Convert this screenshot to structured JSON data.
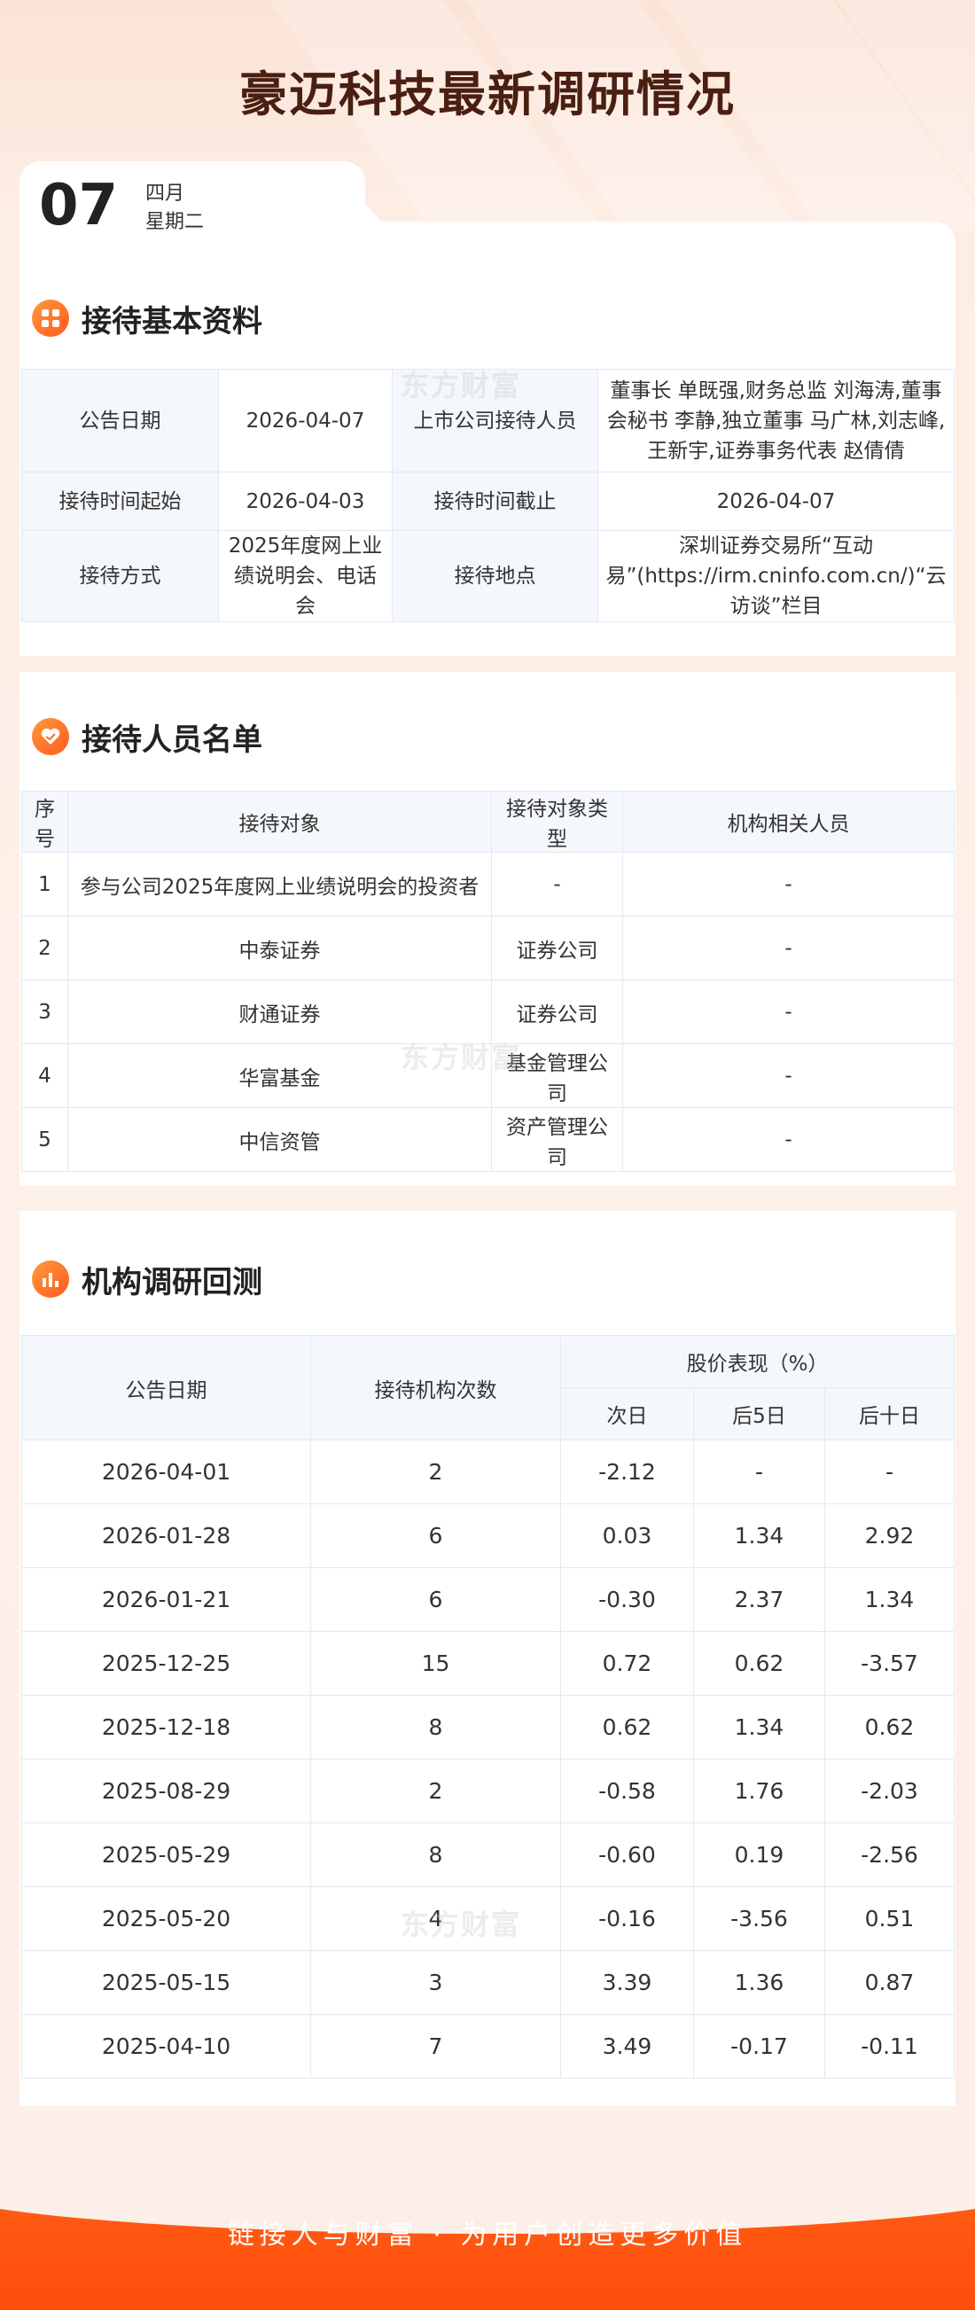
{
  "page": {
    "title": "豪迈科技最新调研情况",
    "date": {
      "day": "07",
      "month": "四月",
      "weekday": "星期二"
    },
    "watermark": "东方财富",
    "footer_slogan": "链接人与财富 · 为用户创造更多价值",
    "colors": {
      "accent": "#ff5a1f",
      "title": "#4a1f12",
      "header_bg": "#f4f8fc"
    }
  },
  "basic": {
    "section_title": "接待基本资料",
    "icon": "grid-icon",
    "announce_date_label": "公告日期",
    "announce_date": "2026-04-07",
    "receivers_label": "上市公司接待人员",
    "receivers": "董事长 单既强,财务总监 刘海涛,董事会秘书 李静,独立董事 马广林,刘志峰,王新宇,证券事务代表 赵倩倩",
    "start_label": "接待时间起始",
    "start": "2026-04-03",
    "end_label": "接待时间截止",
    "end": "2026-04-07",
    "method_label": "接待方式",
    "method": "2025年度网上业绩说明会、电话会",
    "place_label": "接待地点",
    "place": "深圳证券交易所“互动易”(https://irm.cninfo.com.cn/)“云访谈”栏目"
  },
  "visitors": {
    "section_title": "接待人员名单",
    "icon": "handshake-icon",
    "headers": [
      "序号",
      "接待对象",
      "接待对象类型",
      "机构相关人员"
    ],
    "rows": [
      [
        "1",
        "参与公司2025年度网上业绩说明会的投资者",
        "-",
        "-"
      ],
      [
        "2",
        "中泰证券",
        "证券公司",
        "-"
      ],
      [
        "3",
        "财通证券",
        "证券公司",
        "-"
      ],
      [
        "4",
        "华富基金",
        "基金管理公司",
        "-"
      ],
      [
        "5",
        "中信资管",
        "资产管理公司",
        "-"
      ]
    ]
  },
  "backtest": {
    "section_title": "机构调研回测",
    "icon": "bar-chart-icon",
    "headers": {
      "date": "公告日期",
      "count": "接待机构次数",
      "perf": "股价表现（%）",
      "next_day": "次日",
      "after5": "后5日",
      "after10": "后十日"
    },
    "rows": [
      [
        "2026-04-01",
        "2",
        "-2.12",
        "-",
        "-"
      ],
      [
        "2026-01-28",
        "6",
        "0.03",
        "1.34",
        "2.92"
      ],
      [
        "2026-01-21",
        "6",
        "-0.30",
        "2.37",
        "1.34"
      ],
      [
        "2025-12-25",
        "15",
        "0.72",
        "0.62",
        "-3.57"
      ],
      [
        "2025-12-18",
        "8",
        "0.62",
        "1.34",
        "0.62"
      ],
      [
        "2025-08-29",
        "2",
        "-0.58",
        "1.76",
        "-2.03"
      ],
      [
        "2025-05-29",
        "8",
        "-0.60",
        "0.19",
        "-2.56"
      ],
      [
        "2025-05-20",
        "4",
        "-0.16",
        "-3.56",
        "0.51"
      ],
      [
        "2025-05-15",
        "3",
        "3.39",
        "1.36",
        "0.87"
      ],
      [
        "2025-04-10",
        "7",
        "3.49",
        "-0.17",
        "-0.11"
      ]
    ]
  }
}
